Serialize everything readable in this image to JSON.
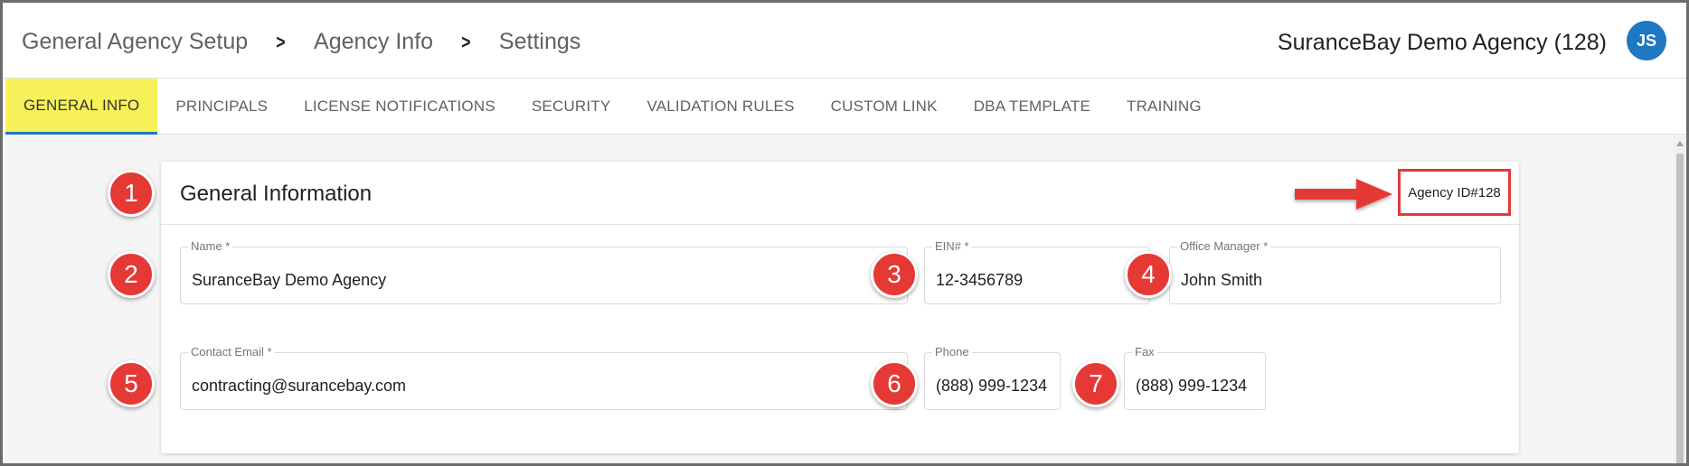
{
  "header": {
    "breadcrumb": [
      "General Agency Setup",
      "Agency Info",
      "Settings"
    ],
    "agency_title": "SuranceBay Demo Agency (128)",
    "avatar_initials": "JS",
    "avatar_color": "#1e78c2"
  },
  "tabs": [
    {
      "label": "GENERAL INFO",
      "active": true
    },
    {
      "label": "PRINCIPALS",
      "active": false
    },
    {
      "label": "LICENSE NOTIFICATIONS",
      "active": false
    },
    {
      "label": "SECURITY",
      "active": false
    },
    {
      "label": "VALIDATION RULES",
      "active": false
    },
    {
      "label": "CUSTOM LINK",
      "active": false
    },
    {
      "label": "DBA TEMPLATE",
      "active": false
    },
    {
      "label": "TRAINING",
      "active": false
    }
  ],
  "card": {
    "title": "General Information",
    "agency_id": "Agency ID#128"
  },
  "fields": {
    "name": {
      "label": "Name *",
      "value": "SuranceBay Demo Agency"
    },
    "ein": {
      "label": "EIN# *",
      "value": "12-3456789"
    },
    "office_manager": {
      "label": "Office Manager *",
      "value": "John Smith"
    },
    "contact_email": {
      "label": "Contact Email *",
      "value": "contracting@surancebay.com"
    },
    "phone": {
      "label": "Phone",
      "value": "(888) 999-1234"
    },
    "fax": {
      "label": "Fax",
      "value": "(888) 999-1234"
    }
  },
  "markers": [
    "1",
    "2",
    "3",
    "4",
    "5",
    "6",
    "7"
  ],
  "colors": {
    "active_tab_bg": "#f7f15a",
    "accent_blue": "#1e78c2",
    "annotation_red": "#e53935"
  }
}
